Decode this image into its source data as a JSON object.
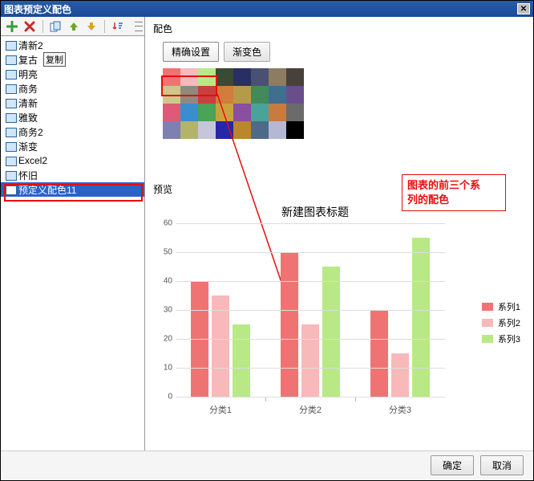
{
  "title": "图表预定义配色",
  "toolbar_icons": [
    "add-icon",
    "delete-icon",
    "copy-icon",
    "up-icon",
    "down-icon",
    "sort-icon"
  ],
  "list_items": [
    {
      "label": "清新2"
    },
    {
      "label": "复古",
      "badge": "复制"
    },
    {
      "label": "明亮"
    },
    {
      "label": "商务"
    },
    {
      "label": "清新"
    },
    {
      "label": "雅致"
    },
    {
      "label": "商务2"
    },
    {
      "label": "渐变"
    },
    {
      "label": "Excel2"
    },
    {
      "label": "怀旧"
    },
    {
      "label": "预定义配色11",
      "selected": true
    }
  ],
  "section_palette_label": "配色",
  "tabs": [
    {
      "label": "精确设置",
      "active": true
    },
    {
      "label": "渐变色"
    }
  ],
  "palette_colors": [
    "#f07374",
    "#f7b9ba",
    "#b8e986",
    "#3b4a33",
    "#2a2f63",
    "#4a5073",
    "#8c7c62",
    "#48403b",
    "#cfc78a",
    "#8c8b7e",
    "#c7403e",
    "#d17d3c",
    "#b49b4a",
    "#428a5b",
    "#3f6e8e",
    "#6a4e8b",
    "#de5a78",
    "#3a8dcf",
    "#4aa356",
    "#c9a23f",
    "#8a4ea3",
    "#4aa39a",
    "#c97a3f",
    "#6b6b6b",
    "#7f80b2",
    "#b3b36a",
    "#c6c6da",
    "#2626a8",
    "#b8882a",
    "#4d6a88",
    "#b5b8d3",
    "#000000"
  ],
  "annotation_line1": "图表的前三个系",
  "annotation_line2": "列的配色",
  "section_preview_label": "预览",
  "chart_data": {
    "type": "bar",
    "title": "新建图表标题",
    "categories": [
      "分类1",
      "分类2",
      "分类3"
    ],
    "series": [
      {
        "name": "系列1",
        "color": "#f07374",
        "values": [
          40,
          50,
          30
        ]
      },
      {
        "name": "系列2",
        "color": "#f7b9ba",
        "values": [
          35,
          25,
          15
        ]
      },
      {
        "name": "系列3",
        "color": "#b8e986",
        "values": [
          25,
          45,
          55
        ]
      }
    ],
    "ylim": [
      0,
      60
    ],
    "yticks": [
      0,
      10,
      20,
      30,
      40,
      50,
      60
    ]
  },
  "buttons": {
    "ok": "确定",
    "cancel": "取消"
  }
}
